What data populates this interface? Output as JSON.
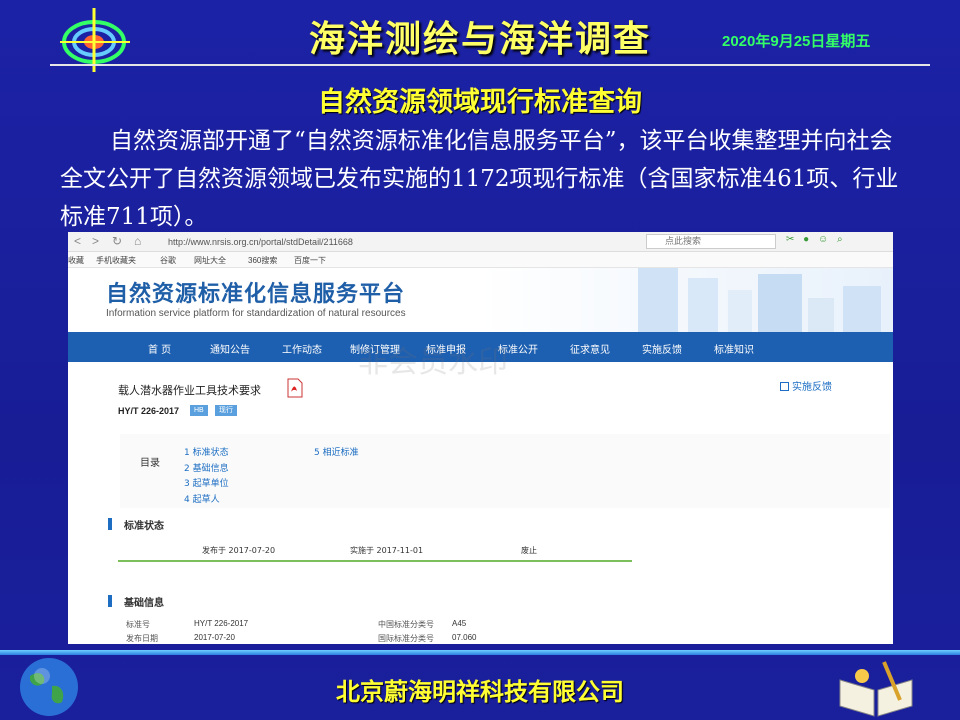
{
  "header": {
    "title": "海洋测绘与海洋调查",
    "date": "2020年9月25日星期五"
  },
  "subtitle": "自然资源领域现行标准查询",
  "body_text": "自然资源部开通了“自然资源标准化信息服务平台”，该平台收集整理并向社会全文公开了自然资源领域已发布实施的1172项现行标准（含国家标准461项、行业标准711项）。",
  "browser": {
    "url": "http://www.nrsis.org.cn/portal/stdDetail/211668",
    "search_placeholder": "点此搜索",
    "bookmarks": [
      "收藏",
      "手机收藏夹",
      "谷歌",
      "网址大全",
      "360搜索",
      "百度一下"
    ]
  },
  "site": {
    "title": "自然资源标准化信息服务平台",
    "subtitle": "Information service platform for standardization of natural resources",
    "watermark": "非会员水印",
    "nav": [
      "首 页",
      "通知公告",
      "工作动态",
      "制修订管理",
      "标准申报",
      "标准公开",
      "征求意见",
      "实施反馈",
      "标准知识"
    ]
  },
  "document": {
    "title": "载人潜水器作业工具技术要求",
    "code": "HY/T 226-2017",
    "badges": [
      "HB",
      "现行"
    ],
    "feedback_label": "实施反馈",
    "toc_label": "目录",
    "toc": [
      "1  标准状态",
      "2  基础信息",
      "3  起草单位",
      "4  起草人",
      "5  相近标准"
    ],
    "status_section": "标准状态",
    "published": "发布于 2017-07-20",
    "implemented": "实施于 2017-11-01",
    "abolished": "废止",
    "basic_section": "基础信息",
    "basic_info": [
      {
        "label": "标准号",
        "value": "HY/T 226-2017"
      },
      {
        "label": "发布日期",
        "value": "2017-07-20"
      },
      {
        "label": "中国标准分类号",
        "value": "A45"
      },
      {
        "label": "国际标准分类号",
        "value": "07.060"
      }
    ]
  },
  "footer": {
    "company": "北京蔚海明祥科技有限公司"
  }
}
